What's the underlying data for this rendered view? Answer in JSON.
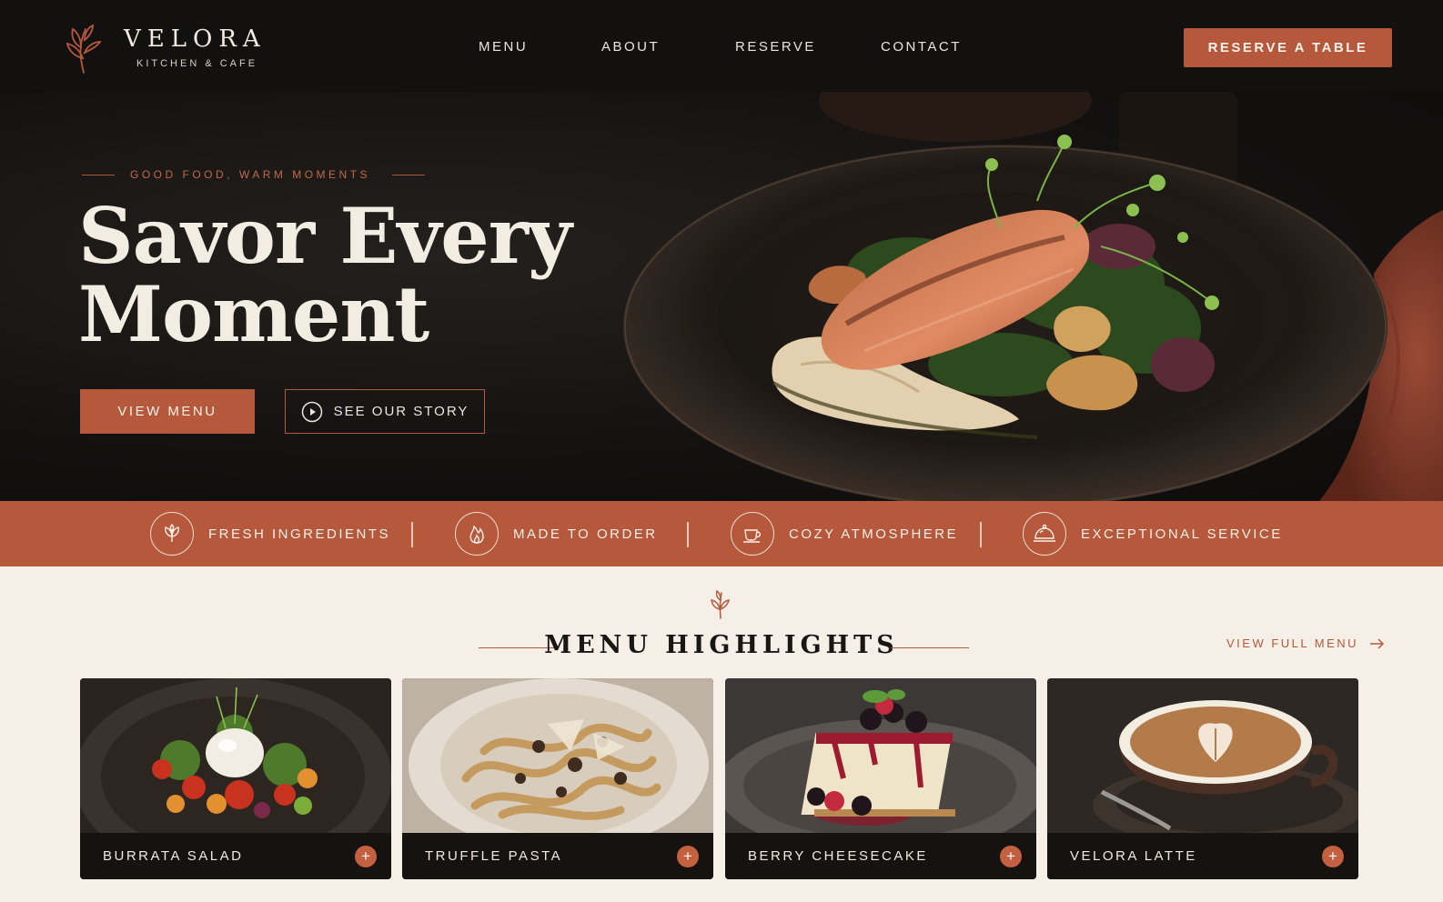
{
  "brand": {
    "name": "VELORA",
    "tagline": "KITCHEN & CAFE"
  },
  "nav": {
    "items": [
      {
        "label": "MENU"
      },
      {
        "label": "ABOUT"
      },
      {
        "label": "RESERVE"
      },
      {
        "label": "CONTACT"
      }
    ],
    "cta_label": "RESERVE A TABLE"
  },
  "hero": {
    "eyebrow": "GOOD FOOD, WARM MOMENTS",
    "title_line1": "Savor Every",
    "title_line2": "Moment",
    "primary_button": "VIEW MENU",
    "secondary_button": "SEE OUR STORY"
  },
  "features": [
    {
      "icon": "leaf-icon",
      "label": "FRESH INGREDIENTS"
    },
    {
      "icon": "flame-icon",
      "label": "MADE TO ORDER"
    },
    {
      "icon": "coffee-cup-icon",
      "label": "COZY ATMOSPHERE"
    },
    {
      "icon": "cloche-icon",
      "label": "EXCEPTIONAL SERVICE"
    }
  ],
  "highlights": {
    "title": "MENU HIGHLIGHTS",
    "view_all": "VIEW FULL MENU",
    "items": [
      {
        "name": "BURRATA SALAD"
      },
      {
        "name": "TRUFFLE PASTA"
      },
      {
        "name": "BERRY CHEESECAKE"
      },
      {
        "name": "VELORA LATTE"
      }
    ]
  },
  "colors": {
    "accent": "#b5583b",
    "dark": "#131110",
    "cream": "#f5efe8"
  }
}
